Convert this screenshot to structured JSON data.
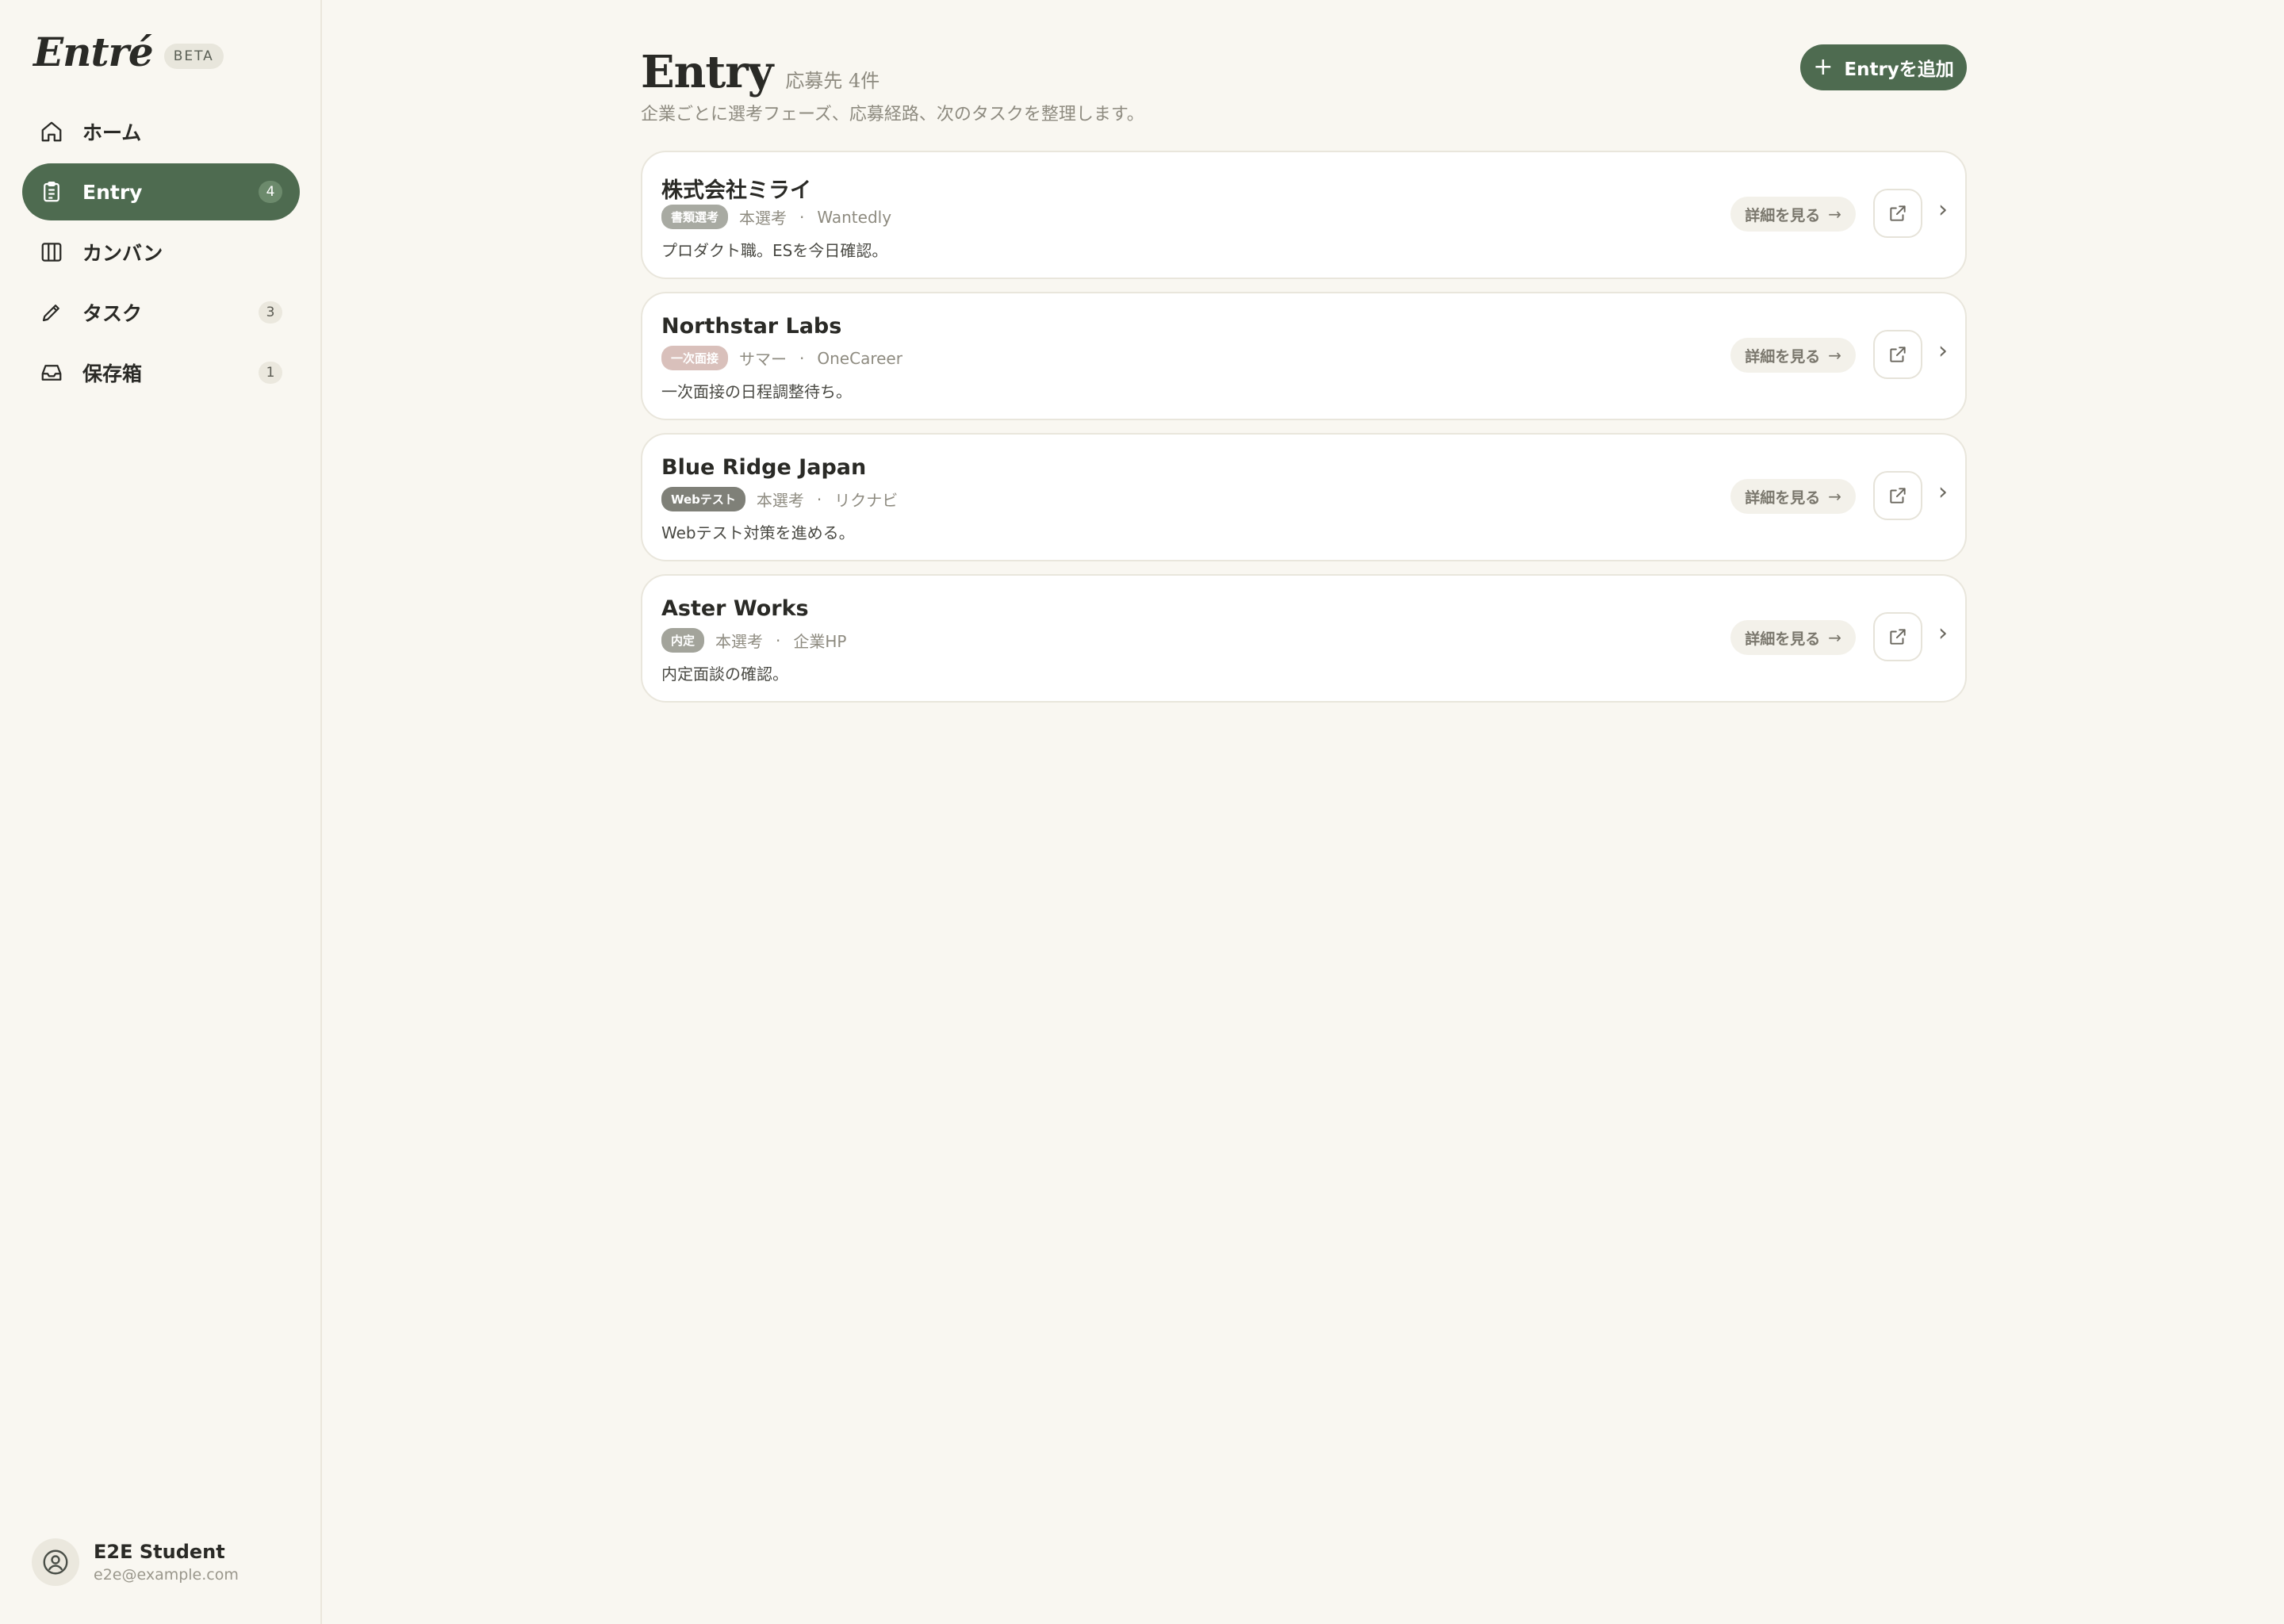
{
  "brand": {
    "logo": "Entré",
    "badge": "BETA"
  },
  "sidebar": {
    "items": [
      {
        "label": "ホーム",
        "icon": "home-icon",
        "badge": null,
        "active": false
      },
      {
        "label": "Entry",
        "icon": "clipboard-icon",
        "badge": "4",
        "active": true
      },
      {
        "label": "カンバン",
        "icon": "kanban-icon",
        "badge": null,
        "active": false
      },
      {
        "label": "タスク",
        "icon": "pencil-icon",
        "badge": "3",
        "active": false
      },
      {
        "label": "保存箱",
        "icon": "inbox-icon",
        "badge": "1",
        "active": false
      }
    ]
  },
  "user": {
    "name": "E2E Student",
    "email": "e2e@example.com"
  },
  "header": {
    "title": "Entry",
    "count": "応募先 4件",
    "subtitle": "企業ごとに選考フェーズ、応募経路、次のタスクを整理します。",
    "add_label": "Entryを追加"
  },
  "entries": [
    {
      "company": "株式会社ミライ",
      "tag": "書類選考",
      "tag_color": "#a8aaa2",
      "type": "本選考",
      "source": "Wantedly",
      "note": "プロダクト職。ESを今日確認。",
      "detail_label": "詳細を見る"
    },
    {
      "company": "Northstar Labs",
      "tag": "一次面接",
      "tag_color": "#d9c0bb",
      "type": "サマー",
      "source": "OneCareer",
      "note": "一次面接の日程調整待ち。",
      "detail_label": "詳細を見る"
    },
    {
      "company": "Blue Ridge Japan",
      "tag": "Webテスト",
      "tag_color": "#7f8078",
      "type": "本選考",
      "source": "リクナビ",
      "note": "Webテスト対策を進める。",
      "detail_label": "詳細を見る"
    },
    {
      "company": "Aster Works",
      "tag": "内定",
      "tag_color": "#a3a49b",
      "type": "本選考",
      "source": "企業HP",
      "note": "内定面談の確認。",
      "detail_label": "詳細を見る"
    }
  ],
  "colors": {
    "accent": "#4e6b50",
    "background": "#f9f7f1"
  }
}
